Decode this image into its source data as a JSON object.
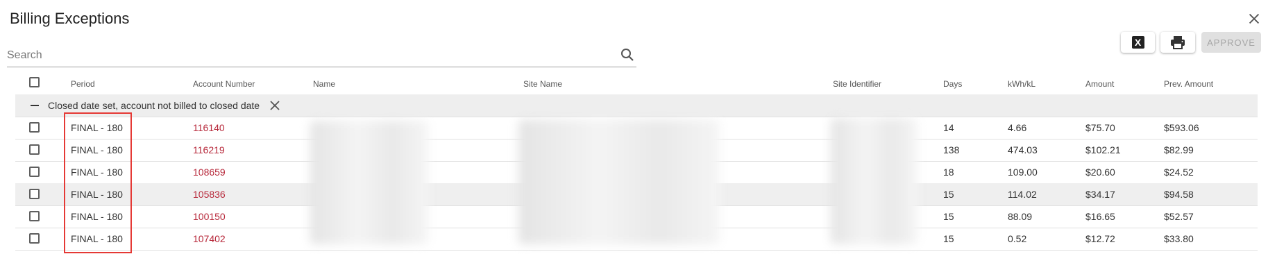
{
  "dialog": {
    "title": "Billing Exceptions"
  },
  "search": {
    "placeholder": "Search",
    "value": ""
  },
  "toolbar": {
    "excel_icon_letter": "X",
    "approve_label": "APPROVE"
  },
  "columns": [
    "Period",
    "Account Number",
    "Name",
    "Site Name",
    "Site Identifier",
    "Days",
    "kWh/kL",
    "Amount",
    "Prev. Amount"
  ],
  "group": {
    "label": "Closed date set, account not billed to closed date"
  },
  "rows": [
    {
      "period": "FINAL - 180",
      "account": "116140",
      "days": "14",
      "kwh": "4.66",
      "amount": "$75.70",
      "prev_amount": "$593.06"
    },
    {
      "period": "FINAL - 180",
      "account": "116219",
      "days": "138",
      "kwh": "474.03",
      "amount": "$102.21",
      "prev_amount": "$82.99"
    },
    {
      "period": "FINAL - 180",
      "account": "108659",
      "days": "18",
      "kwh": "109.00",
      "amount": "$20.60",
      "prev_amount": "$24.52"
    },
    {
      "period": "FINAL - 180",
      "account": "105836",
      "days": "15",
      "kwh": "114.02",
      "amount": "$34.17",
      "prev_amount": "$94.58"
    },
    {
      "period": "FINAL - 180",
      "account": "100150",
      "days": "15",
      "kwh": "88.09",
      "amount": "$16.65",
      "prev_amount": "$52.57"
    },
    {
      "period": "FINAL - 180",
      "account": "107402",
      "days": "15",
      "kwh": "0.52",
      "amount": "$12.72",
      "prev_amount": "$33.80"
    }
  ],
  "icons": {
    "close": "close-icon",
    "search": "search-icon",
    "excel": "excel-icon",
    "print": "print-icon",
    "group_collapse": "minus-icon",
    "group_remove": "close-icon"
  },
  "colors": {
    "account_link": "#b7283a",
    "highlight_border": "#e53935",
    "group_background": "#eeeeee",
    "approve_disabled": "#e0e0e0"
  }
}
